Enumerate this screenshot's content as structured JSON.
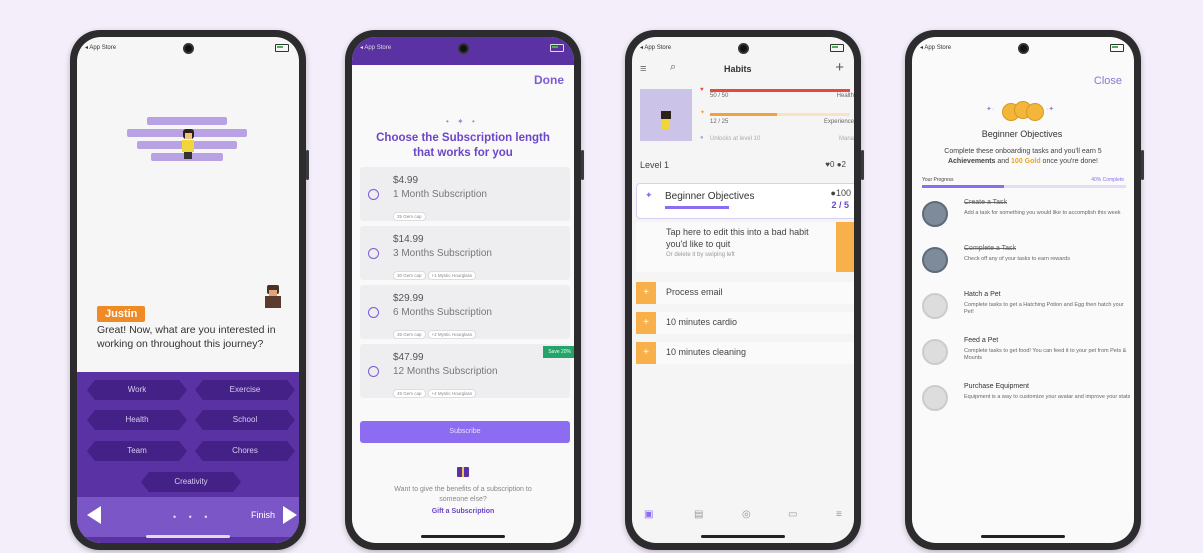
{
  "status": {
    "store_label": "◂ App Store"
  },
  "colors": {
    "purple": "#5a32a3",
    "accent": "#8c6cf0",
    "orange": "#f8b04a",
    "background": "#f4eefa"
  },
  "phone1": {
    "speaker": "Justin",
    "message": "Great! Now, what are you interested in working on throughout this journey?",
    "options": [
      "Work",
      "Exercise",
      "Health",
      "School",
      "Team",
      "Chores",
      "Creativity"
    ],
    "dots": "• • •",
    "finish_label": "Finish"
  },
  "phone2": {
    "done_label": "Done",
    "sparkle": "• ✦ •",
    "title": "Choose the Subscription length that works for you",
    "options": [
      {
        "price": "$4.99",
        "name": "1 Month Subscription",
        "tags": [
          "25 Gem cap"
        ],
        "save": ""
      },
      {
        "price": "$14.99",
        "name": "3 Months Subscription",
        "tags": [
          "30 Gem cap",
          "+1 Mystic Hourglass"
        ],
        "save": ""
      },
      {
        "price": "$29.99",
        "name": "6 Months Subscription",
        "tags": [
          "35 Gem cap",
          "+2 Mystic Hourglass"
        ],
        "save": ""
      },
      {
        "price": "$47.99",
        "name": "12 Months Subscription",
        "tags": [
          "45 Gem cap",
          "+4 Mystic Hourglass"
        ],
        "save": "Save 20%"
      }
    ],
    "subscribe_label": "Subscribe",
    "gift_text": "Want to give the benefits of a subscription to someone else?",
    "gift_link": "Gift a Subscription"
  },
  "phone3": {
    "title": "Habits",
    "health_value": "50 / 50",
    "health_label": "Health",
    "health_fraction": 1.0,
    "exp_value": "12 / 25",
    "exp_label": "Experience",
    "exp_fraction": 0.48,
    "mana_value": "Unlocks at level 10",
    "mana_label": "Mana",
    "level": "Level 1",
    "gems": "♥0  ●2",
    "objective_title": "Beginner Objectives",
    "objective_gold": "●100",
    "objective_progress": "2 / 5",
    "objective_fraction": 0.4,
    "habit_title": "Tap here to edit this into a bad habit you'd like to quit",
    "habit_sub": "Or delete it by swiping left",
    "tasks": [
      "Process email",
      "10 minutes cardio",
      "10 minutes cleaning"
    ]
  },
  "phone4": {
    "close_label": "Close",
    "title": "Beginner Objectives",
    "desc_a": "Complete these onboarding tasks and you'll earn 5",
    "desc_b": "Achievements",
    "desc_c": " and ",
    "desc_d": "100 Gold",
    "desc_e": " once you're done!",
    "progress_label": "Your Progress",
    "progress_pct": "40% Complete",
    "progress_fraction": 0.4,
    "items": [
      {
        "title": "Create a Task",
        "desc": "Add a task for something you would like to accomplish this week",
        "done": true
      },
      {
        "title": "Complete a Task",
        "desc": "Check off any of your tasks to earn rewards",
        "done": true
      },
      {
        "title": "Hatch a Pet",
        "desc": "Complete tasks to get a Hatching Potion and Egg then hatch your Pet!",
        "done": false
      },
      {
        "title": "Feed a Pet",
        "desc": "Complete tasks to get food! You can feed it to your pet from Pets & Mounts",
        "done": false
      },
      {
        "title": "Purchase Equipment",
        "desc": "Equipment is a way to customize your avatar and improve your stats",
        "done": false
      }
    ]
  }
}
